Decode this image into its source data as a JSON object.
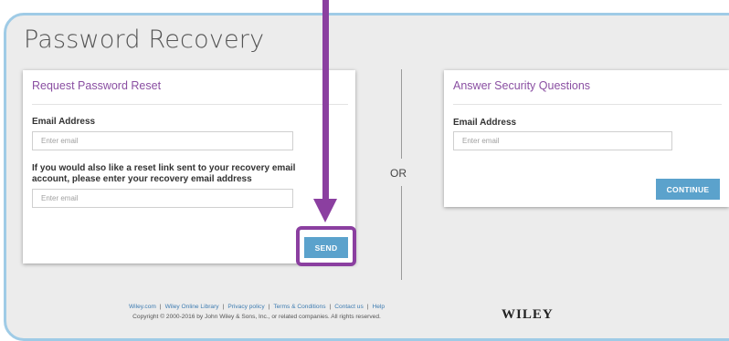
{
  "page": {
    "title": "Password Recovery"
  },
  "request_reset": {
    "title": "Request Password Reset",
    "email_label": "Email Address",
    "email_placeholder": "Enter email",
    "recovery_label_line1": "If you would also like a reset link sent to your recovery email",
    "recovery_label_line2": "account, please enter your recovery email address",
    "recovery_placeholder": "Enter email",
    "send_label": "SEND"
  },
  "separator": {
    "or_label": "OR"
  },
  "security_questions": {
    "title": "Answer Security Questions",
    "email_label": "Email Address",
    "email_placeholder": "Enter email",
    "continue_label": "CONTINUE"
  },
  "footer": {
    "links": [
      "Wiley.com",
      "Wiley Online Library",
      "Privacy policy",
      "Terms & Conditions",
      "Contact us",
      "Help"
    ],
    "link_separator": "|",
    "copyright": "Copyright © 2000-2016 by John Wiley & Sons, Inc., or related companies. All rights reserved.",
    "logo_text": "WILEY"
  },
  "colors": {
    "accent_purple": "#8b3fa0",
    "button_blue": "#5ba2cc",
    "frame_border": "#9fcbe6",
    "link_blue": "#3e7cb1"
  },
  "annotations": {
    "arrow_icon": "down-arrow-icon",
    "highlight": "send-button-highlight"
  }
}
